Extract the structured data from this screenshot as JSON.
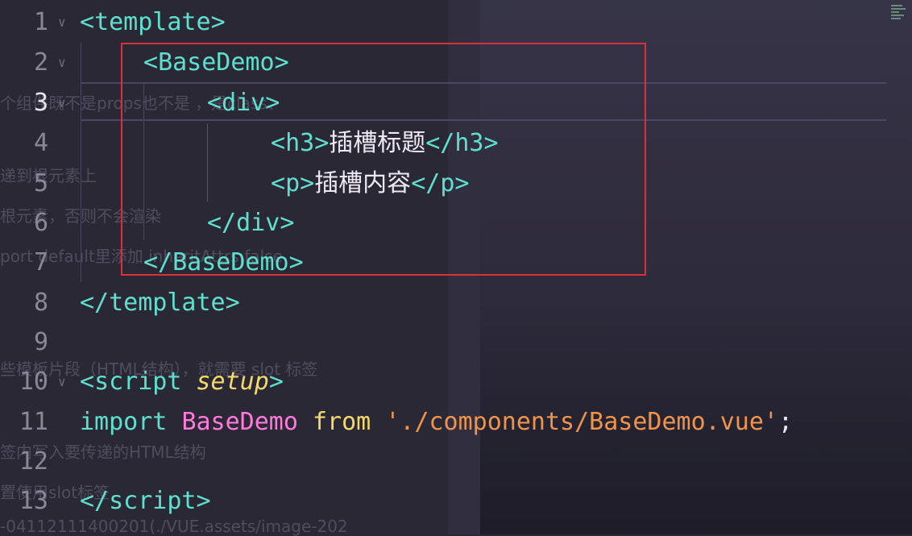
{
  "editor": {
    "lines": [
      {
        "num": "1",
        "fold": "∨"
      },
      {
        "num": "2",
        "fold": "∨"
      },
      {
        "num": "3",
        "fold": "∨"
      },
      {
        "num": "4",
        "fold": ""
      },
      {
        "num": "5",
        "fold": ""
      },
      {
        "num": "6",
        "fold": ""
      },
      {
        "num": "7",
        "fold": ""
      },
      {
        "num": "8",
        "fold": ""
      },
      {
        "num": "9",
        "fold": ""
      },
      {
        "num": "10",
        "fold": "∨"
      },
      {
        "num": "11",
        "fold": ""
      },
      {
        "num": "12",
        "fold": ""
      },
      {
        "num": "13",
        "fold": ""
      }
    ],
    "code": {
      "l1": {
        "open": "<",
        "tag": "template",
        "close": ">"
      },
      "l2": {
        "open": "<",
        "tag": "BaseDemo",
        "close": ">"
      },
      "l3": {
        "open": "<",
        "tag": "div",
        "close": ">"
      },
      "l4": {
        "open": "<",
        "tag": "h3",
        "close": ">",
        "text": "插槽标题",
        "endopen": "</",
        "endtag": "h3",
        "endclose": ">"
      },
      "l5": {
        "open": "<",
        "tag": "p",
        "close": ">",
        "text": "插槽内容",
        "endopen": "</",
        "endtag": "p",
        "endclose": ">"
      },
      "l6": {
        "open": "</",
        "tag": "div",
        "close": ">"
      },
      "l7": {
        "open": "</",
        "tag": "BaseDemo",
        "close": ">"
      },
      "l8": {
        "open": "</",
        "tag": "template",
        "close": ">"
      },
      "l10": {
        "open": "<",
        "tag": "script",
        "attr": "setup",
        "close": ">"
      },
      "l11": {
        "kw": "import",
        "ident": "BaseDemo",
        "from": "from",
        "str": "'./components/BaseDemo.vue'",
        "semi": ";"
      },
      "l13": {
        "open": "</",
        "tag": "script",
        "close": ">"
      }
    }
  },
  "background_text": [
    "个组件既不是props也不是      ，是class、",
    "递到根元素上",
    "根元素，否则不会渲染",
    "port default里添加 inheritAttrs:false",
    "些模板片段（HTML结构），就需要 slot 标签",
    "签内写入要传递的HTML结构",
    "置使用slot标签",
    "-04112111400201(./VUE.assets/image-202"
  ],
  "colors": {
    "background": "#2b2836",
    "tag": "#5ee0cf",
    "attribute": "#f4da6a",
    "identifier": "#ff7ad9",
    "string": "#f0944b",
    "highlight_box": "#d9303a"
  }
}
